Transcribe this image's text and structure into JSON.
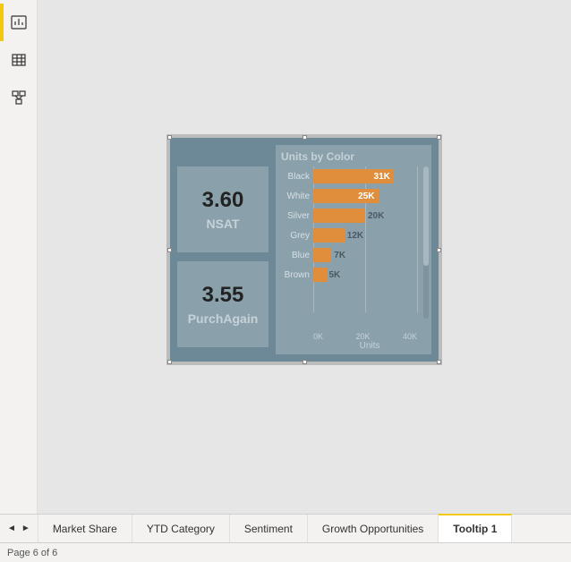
{
  "view_rail": {
    "items": [
      {
        "name": "report-view",
        "active": true
      },
      {
        "name": "data-view",
        "active": false
      },
      {
        "name": "model-view",
        "active": false
      }
    ]
  },
  "cards": {
    "nsat": {
      "value": "3.60",
      "label": "NSAT"
    },
    "purch": {
      "value": "3.55",
      "label": "PurchAgain"
    }
  },
  "chart_data": {
    "type": "bar",
    "title": "Units by Color",
    "xlabel": "Units",
    "ylabel": "",
    "xlim": [
      0,
      40000
    ],
    "ticks": [
      "0K",
      "20K",
      "40K"
    ],
    "categories": [
      "Black",
      "White",
      "Silver",
      "Grey",
      "Blue",
      "Brown"
    ],
    "values": [
      31000,
      25000,
      20000,
      12000,
      7000,
      5000
    ],
    "data_labels": [
      "31K",
      "25K",
      "20K",
      "12K",
      "7K",
      "5K"
    ]
  },
  "tabs": {
    "items": [
      {
        "label": "Market Share",
        "active": false
      },
      {
        "label": "YTD Category",
        "active": false
      },
      {
        "label": "Sentiment",
        "active": false
      },
      {
        "label": "Growth Opportunities",
        "active": false
      },
      {
        "label": "Tooltip 1",
        "active": true
      }
    ]
  },
  "status": {
    "page_indicator": "Page 6 of 6"
  }
}
